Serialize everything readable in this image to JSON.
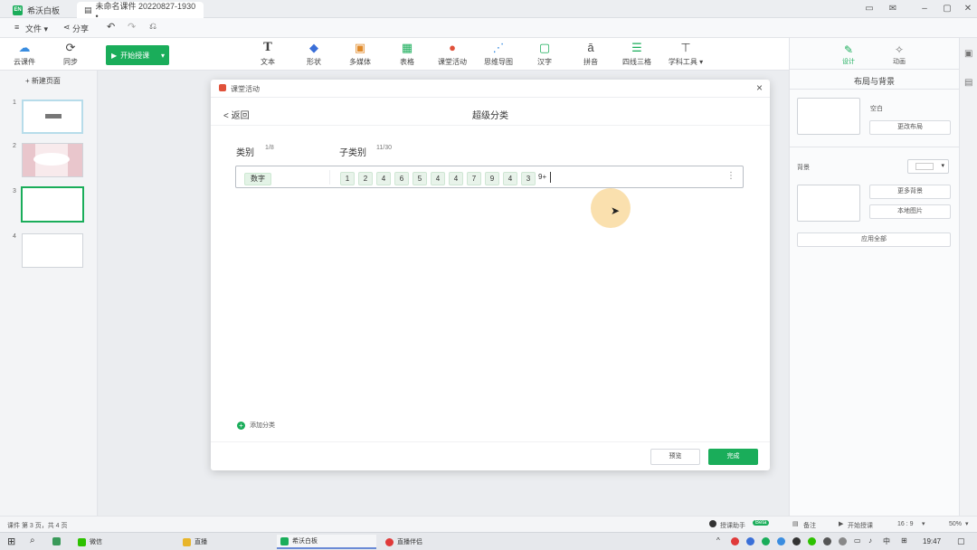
{
  "titlebar": {
    "app_name": "希沃白板",
    "doc_tab": "未命名课件 20220827-1930 •"
  },
  "menu": {
    "file": "文件 ▾",
    "share": "分享"
  },
  "toolbar": {
    "cloud": "云课件",
    "sync": "同步",
    "start": "开始授课",
    "tools": [
      "文本",
      "形状",
      "多媒体",
      "表格",
      "课堂活动",
      "思维导图",
      "汉字",
      "拼音",
      "四线三格",
      "学科工具 ▾"
    ]
  },
  "leftpanel": {
    "new_page": "+ 新建页面",
    "slide_numbers": [
      "1",
      "2",
      "3",
      "4"
    ]
  },
  "rightpanel": {
    "tab_design": "设计",
    "tab_animation": "动画",
    "section_title": "布局与背景",
    "layout_label": "空白",
    "change_layout": "更改布局",
    "background_label": "背景",
    "more_bg": "更多背景",
    "local_image": "本地图片",
    "apply_all": "应用全部"
  },
  "dialog": {
    "header": "课堂活动",
    "back": "< 返回",
    "title": "超级分类",
    "category_label": "类别",
    "category_count": "1/8",
    "subcategory_label": "子类别",
    "subcategory_count": "11/30",
    "category_value": "数字",
    "sub_items": [
      "1",
      "2",
      "4",
      "6",
      "5",
      "4",
      "4",
      "7",
      "9",
      "4",
      "3"
    ],
    "sub_input": "9+",
    "more": "⋮",
    "add_category": "添加分类",
    "preview": "预览",
    "done": "完成"
  },
  "statusbar": {
    "page_info": "课件 第 3 页，共 4 页",
    "assistant": "授课助手",
    "assistant_badge": "Beta",
    "remark": "备注",
    "start": "开始授课",
    "ratio": "16 : 9",
    "zoom": "50%"
  },
  "taskbar": {
    "items": [
      "微信",
      "直播",
      "希沃白板",
      "直播伴侣"
    ],
    "time": "19:47"
  },
  "colors": {
    "accent": "#1aad5a",
    "tag_bg": "#e3f3e6"
  }
}
